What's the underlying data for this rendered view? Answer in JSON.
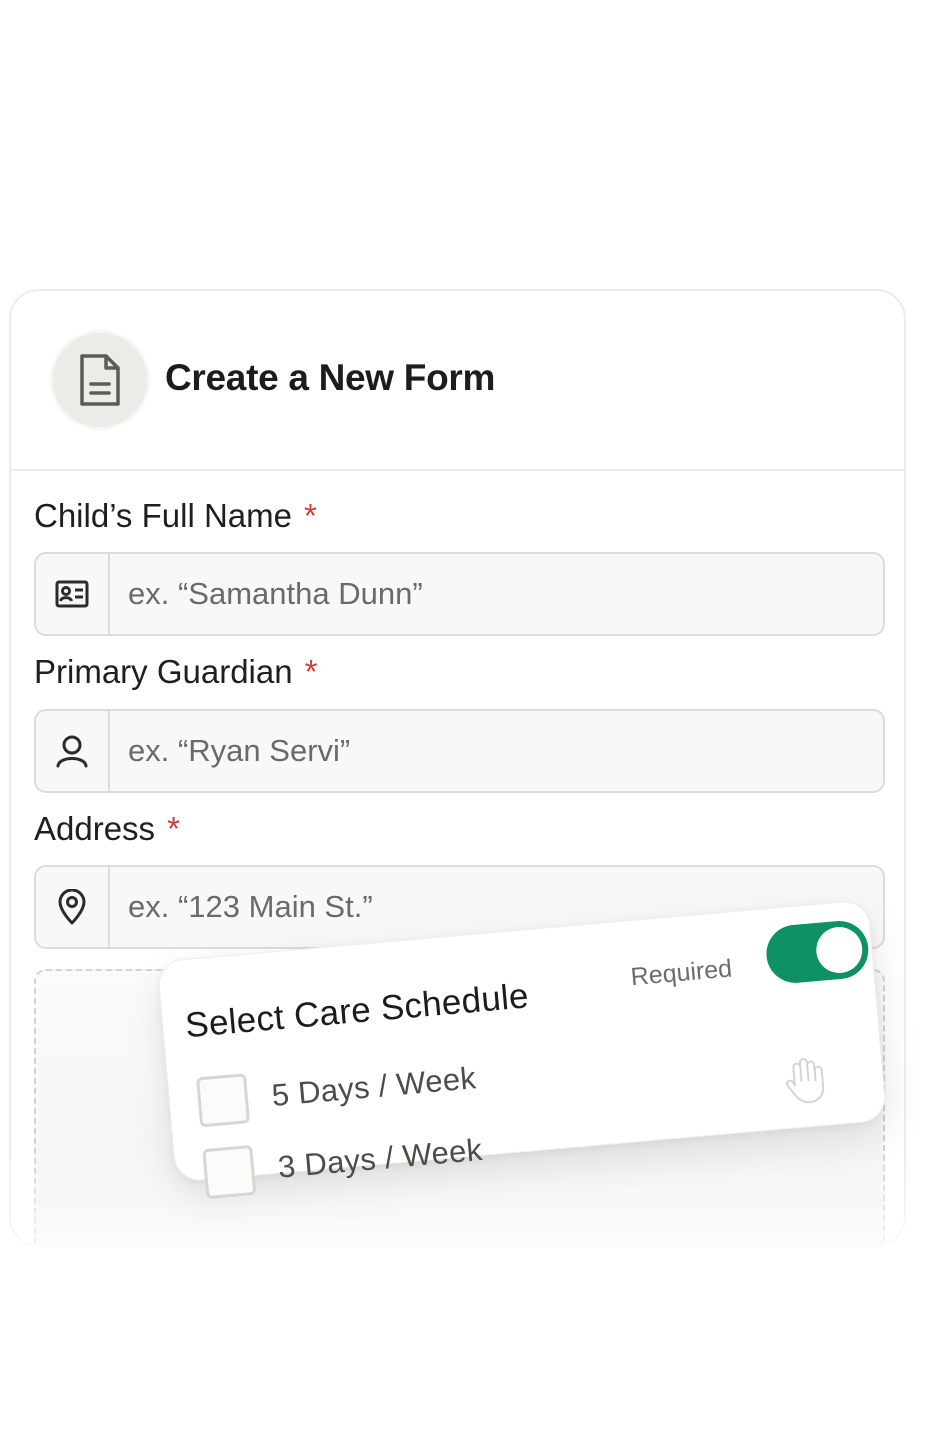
{
  "header": {
    "title": "Create a New Form",
    "icon": "document-icon"
  },
  "fields": [
    {
      "label": "Child’s Full Name",
      "required_mark": "*",
      "placeholder": "ex. “Samantha Dunn”",
      "icon": "id-card-icon"
    },
    {
      "label": "Primary Guardian",
      "required_mark": "*",
      "placeholder": "ex. “Ryan Servi”",
      "icon": "user-icon"
    },
    {
      "label": "Address",
      "required_mark": "*",
      "placeholder": "ex. “123 Main St.”",
      "icon": "location-pin-icon"
    }
  ],
  "schedule_card": {
    "title": "Select Care Schedule",
    "required_label": "Required",
    "required_toggle_on": true,
    "options": [
      {
        "label": "5 Days / Week",
        "checked": false
      },
      {
        "label": "3 Days / Week",
        "checked": false
      }
    ]
  },
  "colors": {
    "toggle_on": "#0e9163",
    "required_asterisk": "#d63a3a",
    "input_bg": "#f8f8f6",
    "border": "#dcdcd8"
  }
}
